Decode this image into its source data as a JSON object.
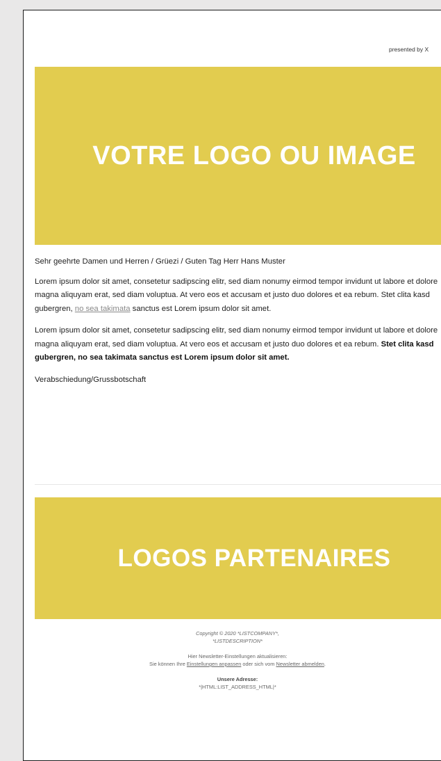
{
  "header": {
    "preheader": "",
    "presented_by": "presented by X"
  },
  "logo_banner": {
    "text": "VOTRE LOGO OU IMAGE",
    "color": "#e2cc4f"
  },
  "body": {
    "greeting": "Sehr geehrte Damen und Herren / Grüezi / Guten Tag Herr Hans Muster",
    "paragraph1": {
      "text": "Lorem ipsum dolor sit amet, consetetur sadipscing elitr, sed diam nonumy eirmod tempor invidunt ut labore et dolore magna aliquyam erat, sed diam voluptua. At vero eos et accusam et justo duo dolores et ea rebum. Stet clita kasd gubergren, ",
      "link": "no sea takimata",
      "end": " sanctus est Lorem ipsum dolor sit amet."
    },
    "paragraph2": {
      "text": "Lorem ipsum dolor sit amet, consetetur sadipscing elitr, sed diam nonumy eirmod tempor invidunt ut labore et dolore magna aliquyam erat, sed diam voluptua. At vero eos et accusam et justo duo dolores et ea rebum. ",
      "bold": "Stet clita kasd gubergren, no sea takimata sanctus est Lorem ipsum dolor sit amet."
    },
    "closing": "Verabschiedung/Grussbotschaft"
  },
  "partners_banner": {
    "text": "LOGOS PARTENAIRES"
  },
  "footer": {
    "copyright_line1": "Copyright © 2020 *LISTCOMPANY*,",
    "copyright_line2": "*LISTDESCRIPTION*",
    "update_line": "Hier Newsletter-Einstellungen aktualisieren:",
    "settings_prefix": "Sie können Ihre ",
    "settings_link": "Einstellungen anpassen",
    "settings_middle": " oder sich vom ",
    "unsubscribe_link": "Newsletter abmelden",
    "settings_suffix": ".",
    "address_label": "Unsere Adresse:",
    "address_value": "*|HTML:LIST_ADDRESS_HTML|*"
  }
}
